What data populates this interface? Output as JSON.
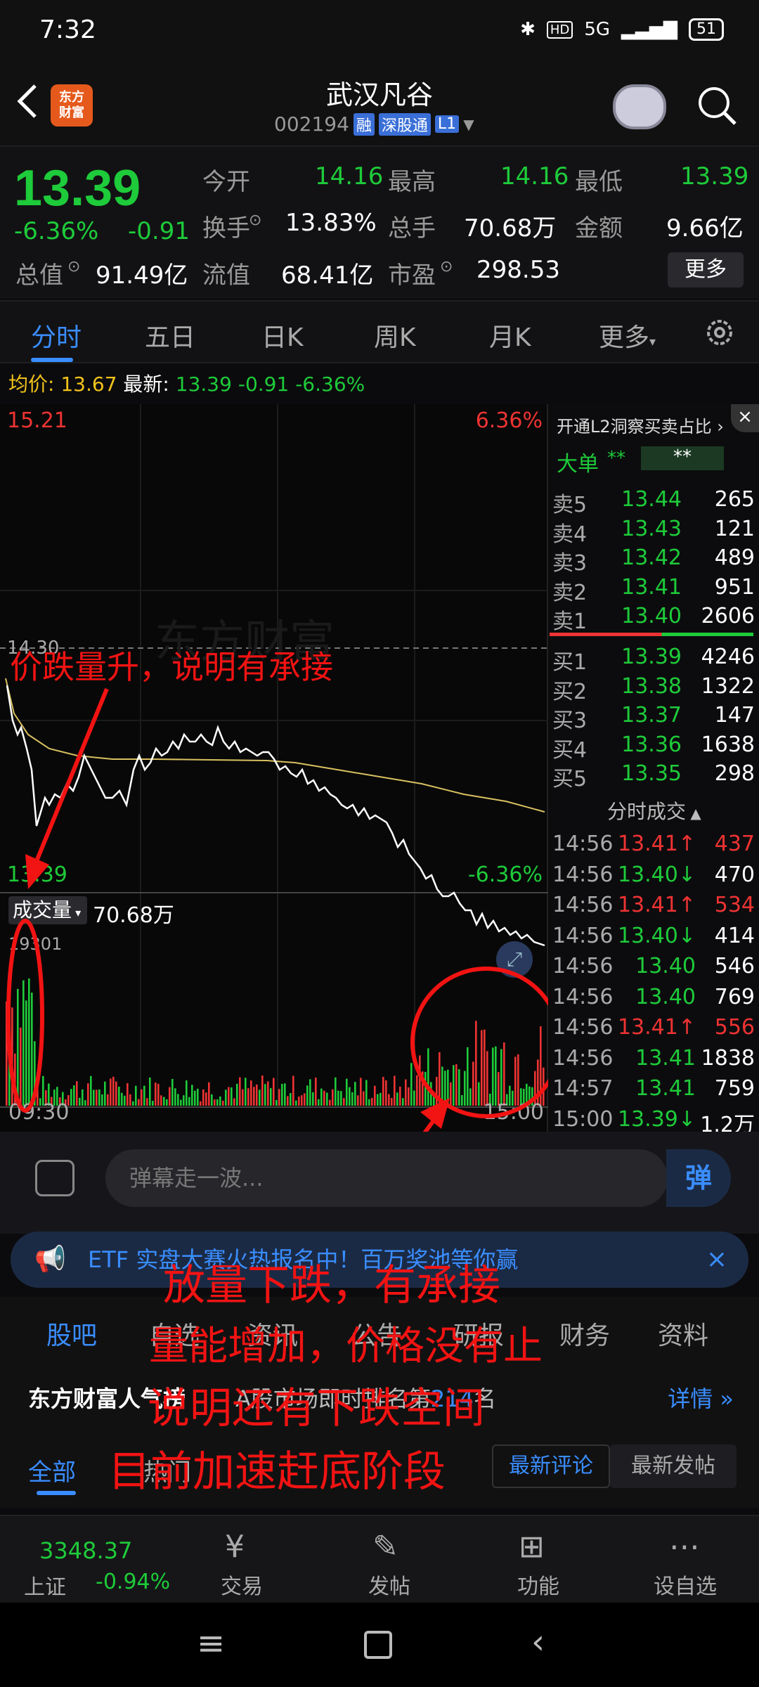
{
  "status": {
    "time": "7:32",
    "network": "5G",
    "hd": "HD",
    "battery": "51"
  },
  "header": {
    "title": "武汉凡谷",
    "code": "002194",
    "tags": [
      "融",
      "深股通",
      "L1"
    ],
    "logo_text": "东方财富"
  },
  "quote": {
    "price": "13.39",
    "pct": "-6.36%",
    "chg": "-0.91",
    "open_label": "今开",
    "open": "14.16",
    "high_label": "最高",
    "high": "14.16",
    "low_label": "最低",
    "low": "13.39",
    "turnover_label": "换手",
    "turnover": "13.83%",
    "volume_label": "总手",
    "volume": "70.68万",
    "amount_label": "金额",
    "amount": "9.66亿",
    "mcap_label": "总值",
    "mcap": "91.49亿",
    "float_label": "流值",
    "float": "68.41亿",
    "pe_label": "市盈",
    "pe": "298.53",
    "more": "更多"
  },
  "tabs": [
    "分时",
    "五日",
    "日K",
    "周K",
    "月K",
    "更多"
  ],
  "avgline": {
    "avg_label": "均价:",
    "avg": "13.67",
    "last_label": "最新:",
    "last": "13.39",
    "chg": "-0.91",
    "pct": "-6.36%"
  },
  "chart": {
    "top_price": "15.21",
    "top_pct": "6.36%",
    "mid_price": "14.30",
    "bottom_price": "13.39",
    "bottom_pct": "-6.36%",
    "vol_label": "成交量",
    "vol_value": "70.68万",
    "vol_max": "19301",
    "time_start": "09:30",
    "time_end": "15:00",
    "watermark": "东方财富"
  },
  "orderbook": {
    "header": "开通L2洞察买卖占比",
    "big_label": "大单",
    "big_v1": "**",
    "big_v2": "**",
    "sells": [
      [
        "卖5",
        "13.44",
        "265"
      ],
      [
        "卖4",
        "13.43",
        "121"
      ],
      [
        "卖3",
        "13.42",
        "489"
      ],
      [
        "卖2",
        "13.41",
        "951"
      ],
      [
        "卖1",
        "13.40",
        "2606"
      ]
    ],
    "buys": [
      [
        "买1",
        "13.39",
        "4246"
      ],
      [
        "买2",
        "13.38",
        "1322"
      ],
      [
        "买3",
        "13.37",
        "147"
      ],
      [
        "买4",
        "13.36",
        "1638"
      ],
      [
        "买5",
        "13.35",
        "298"
      ]
    ],
    "ticks_label": "分时成交",
    "ticks": [
      [
        "14:56",
        "13.41↑",
        "437",
        "r"
      ],
      [
        "14:56",
        "13.40↓",
        "470",
        "g"
      ],
      [
        "14:56",
        "13.41↑",
        "534",
        "r"
      ],
      [
        "14:56",
        "13.40↓",
        "414",
        "g"
      ],
      [
        "14:56",
        "13.40",
        "546",
        "g"
      ],
      [
        "14:56",
        "13.40",
        "769",
        "g"
      ],
      [
        "14:56",
        "13.41↑",
        "556",
        "r"
      ],
      [
        "14:56",
        "13.41",
        "1838",
        "g"
      ],
      [
        "14:57",
        "13.41",
        "759",
        "g"
      ],
      [
        "15:00",
        "13.39↓",
        "1.2万",
        "g"
      ]
    ]
  },
  "annotations": {
    "a1": "价跌量升，说明有承接",
    "a2": "放量下跌，有承接",
    "a3": "量能增加，价格没有止",
    "a4": "说明还有下跌空间",
    "a5": "目前加速赶底阶段"
  },
  "danmu": {
    "placeholder": "弹幕走一波...",
    "btn": "弹"
  },
  "banner": {
    "text": "ETF 实盘大赛火热报名中！百万奖池等你赢"
  },
  "sections": [
    "股吧",
    "自选",
    "资讯",
    "公告",
    "研报",
    "财务",
    "资料"
  ],
  "hot": {
    "brand": "东方财富人气榜",
    "rank_text": "A股市场即时排名第",
    "rank": "214",
    "rank_unit": "名",
    "details": "详情",
    "sub_tabs": [
      "全部",
      "热门",
      "最新评论",
      "最新发帖"
    ]
  },
  "bottomnav": {
    "index_value": "3348.37",
    "index_name": "上证",
    "index_pct": "-0.94%",
    "items": [
      "交易",
      "发帖",
      "功能",
      "设自选"
    ]
  }
}
